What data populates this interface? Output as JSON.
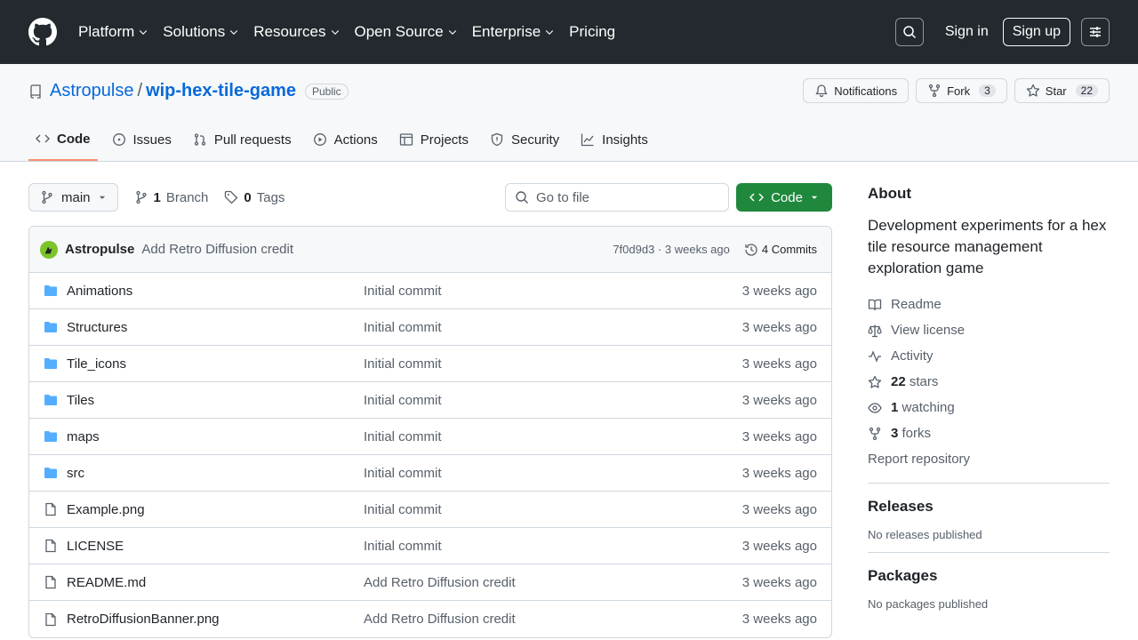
{
  "header": {
    "nav": [
      {
        "label": "Platform",
        "has_menu": true
      },
      {
        "label": "Solutions",
        "has_menu": true
      },
      {
        "label": "Resources",
        "has_menu": true
      },
      {
        "label": "Open Source",
        "has_menu": true
      },
      {
        "label": "Enterprise",
        "has_menu": true
      },
      {
        "label": "Pricing",
        "has_menu": false
      }
    ],
    "signin": "Sign in",
    "signup": "Sign up"
  },
  "repo": {
    "owner": "Astropulse",
    "separator": "/",
    "name": "wip-hex-tile-game",
    "visibility": "Public",
    "notifications_label": "Notifications",
    "fork_label": "Fork",
    "fork_count": "3",
    "star_label": "Star",
    "star_count": "22"
  },
  "repo_nav": [
    {
      "label": "Code",
      "icon": "code-icon",
      "active": true
    },
    {
      "label": "Issues",
      "icon": "issue-icon",
      "active": false
    },
    {
      "label": "Pull requests",
      "icon": "pull-request-icon",
      "active": false
    },
    {
      "label": "Actions",
      "icon": "play-icon",
      "active": false
    },
    {
      "label": "Projects",
      "icon": "table-icon",
      "active": false
    },
    {
      "label": "Security",
      "icon": "shield-icon",
      "active": false
    },
    {
      "label": "Insights",
      "icon": "graph-icon",
      "active": false
    }
  ],
  "toolbar": {
    "branch": "main",
    "branch_count": "1",
    "branch_label": "Branch",
    "tag_count": "0",
    "tag_label": "Tags",
    "goto_placeholder": "Go to file",
    "code_button": "Code"
  },
  "commit": {
    "author": "Astropulse",
    "message": "Add Retro Diffusion credit",
    "sha_time": "7f0d9d3 · 3 weeks ago",
    "commits_label": "4 Commits"
  },
  "files": [
    {
      "name": "Animations",
      "type": "dir",
      "message": "Initial commit",
      "date": "3 weeks ago"
    },
    {
      "name": "Structures",
      "type": "dir",
      "message": "Initial commit",
      "date": "3 weeks ago"
    },
    {
      "name": "Tile_icons",
      "type": "dir",
      "message": "Initial commit",
      "date": "3 weeks ago"
    },
    {
      "name": "Tiles",
      "type": "dir",
      "message": "Initial commit",
      "date": "3 weeks ago"
    },
    {
      "name": "maps",
      "type": "dir",
      "message": "Initial commit",
      "date": "3 weeks ago"
    },
    {
      "name": "src",
      "type": "dir",
      "message": "Initial commit",
      "date": "3 weeks ago"
    },
    {
      "name": "Example.png",
      "type": "file",
      "message": "Initial commit",
      "date": "3 weeks ago"
    },
    {
      "name": "LICENSE",
      "type": "file",
      "message": "Initial commit",
      "date": "3 weeks ago"
    },
    {
      "name": "README.md",
      "type": "file",
      "message": "Add Retro Diffusion credit",
      "date": "3 weeks ago"
    },
    {
      "name": "RetroDiffusionBanner.png",
      "type": "file",
      "message": "Add Retro Diffusion credit",
      "date": "3 weeks ago"
    }
  ],
  "about": {
    "title": "About",
    "description": "Development experiments for a hex tile resource management exploration game",
    "readme": "Readme",
    "license": "View license",
    "activity": "Activity",
    "stars_count": "22",
    "stars_label": "stars",
    "watching_count": "1",
    "watching_label": "watching",
    "forks_count": "3",
    "forks_label": "forks",
    "report": "Report repository"
  },
  "releases": {
    "title": "Releases",
    "text": "No releases published"
  },
  "packages": {
    "title": "Packages",
    "text": "No packages published"
  },
  "colors": {
    "accent": "#0969da",
    "header_bg": "#24292f",
    "code_button": "#1f883d",
    "tab_underline": "#fd8c73",
    "folder": "#54aeff"
  }
}
